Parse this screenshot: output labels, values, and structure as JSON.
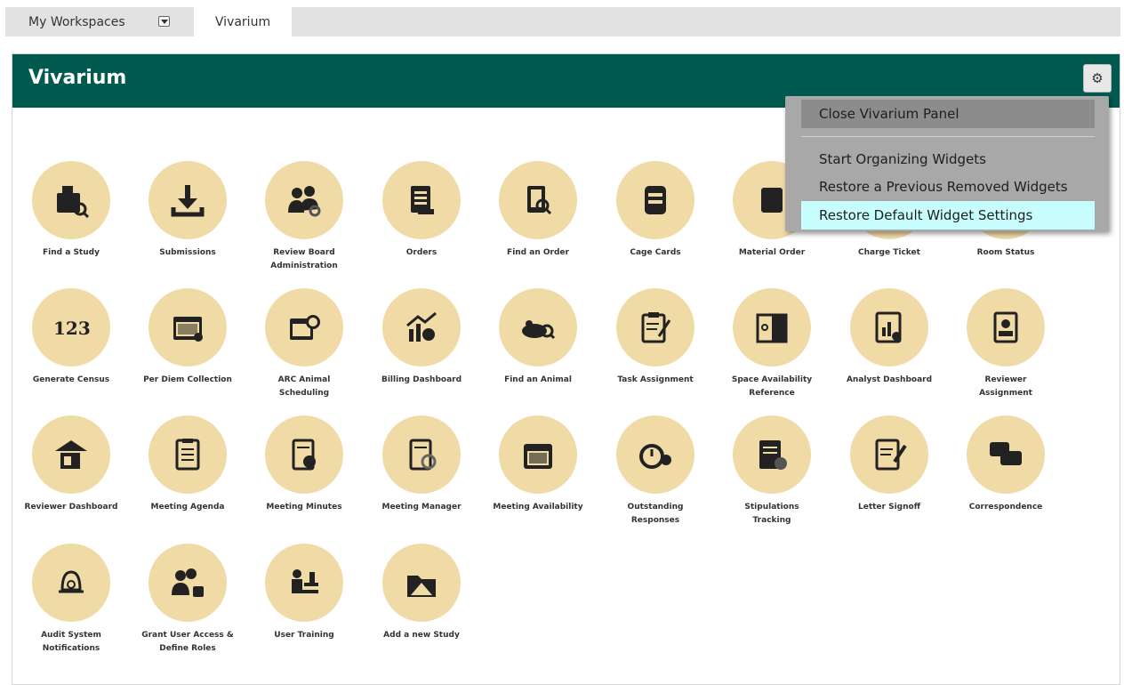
{
  "tabs": {
    "workspaces": "My Workspaces",
    "active": "Vivarium"
  },
  "panel": {
    "title": "Vivarium"
  },
  "menu": {
    "close": "Close Vivarium Panel",
    "organize": "Start Organizing Widgets",
    "restore_removed": "Restore a Previous Removed Widgets",
    "restore_default": "Restore Default Widget Settings"
  },
  "colors": {
    "header": "#005a4f",
    "icon_circle": "#f0dba7",
    "icon": "#222222",
    "menu_bg": "#a8a8a8",
    "menu_highlight": "#c8fdfd"
  },
  "widgets": [
    {
      "label": "Find a Study",
      "icon": "folder-search-icon"
    },
    {
      "label": "Submissions",
      "icon": "download-icon"
    },
    {
      "label": "Review Board\nAdministration",
      "icon": "group-gear-icon"
    },
    {
      "label": "Orders",
      "icon": "document-icon"
    },
    {
      "label": "Find an Order",
      "icon": "document-search-icon"
    },
    {
      "label": "Cage Cards",
      "icon": "cage-card-icon"
    },
    {
      "label": "Material Order",
      "icon": "material-order-icon"
    },
    {
      "label": "Charge Ticket",
      "icon": "charge-ticket-icon"
    },
    {
      "label": "Room Status",
      "icon": "room-status-icon"
    },
    {
      "label": "Generate Census",
      "icon": "census-123-icon"
    },
    {
      "label": "Per Diem Collection",
      "icon": "calendar-check-icon"
    },
    {
      "label": "ARC Animal\nScheduling",
      "icon": "calendar-clock-icon"
    },
    {
      "label": "Billing Dashboard",
      "icon": "chart-money-icon"
    },
    {
      "label": "Find an Animal",
      "icon": "mouse-search-icon"
    },
    {
      "label": "Task Assignment",
      "icon": "clipboard-pen-icon"
    },
    {
      "label": "Space Availability\nReference",
      "icon": "door-icon"
    },
    {
      "label": "Analyst Dashboard",
      "icon": "report-chart-icon"
    },
    {
      "label": "Reviewer\nAssignment",
      "icon": "id-badge-icon"
    },
    {
      "label": "Reviewer Dashboard",
      "icon": "reviewer-dashboard-icon"
    },
    {
      "label": "Meeting Agenda",
      "icon": "checklist-icon"
    },
    {
      "label": "Meeting Minutes",
      "icon": "minutes-clock-icon"
    },
    {
      "label": "Meeting Manager",
      "icon": "manager-gear-icon"
    },
    {
      "label": "Meeting Availability",
      "icon": "calendar-grid-icon"
    },
    {
      "label": "Outstanding\nResponses",
      "icon": "alarm-clock-icon"
    },
    {
      "label": "Stipulations\nTracking",
      "icon": "tracking-icon"
    },
    {
      "label": "Letter Signoff",
      "icon": "letter-sign-icon"
    },
    {
      "label": "Correspondence",
      "icon": "chat-bubbles-icon"
    },
    {
      "label": "Audit System\nNotifications",
      "icon": "bell-search-icon"
    },
    {
      "label": "Grant User Access &\nDefine Roles",
      "icon": "users-lock-icon"
    },
    {
      "label": "User Training",
      "icon": "trainer-icon"
    },
    {
      "label": "Add a new Study",
      "icon": "folder-add-icon"
    }
  ]
}
